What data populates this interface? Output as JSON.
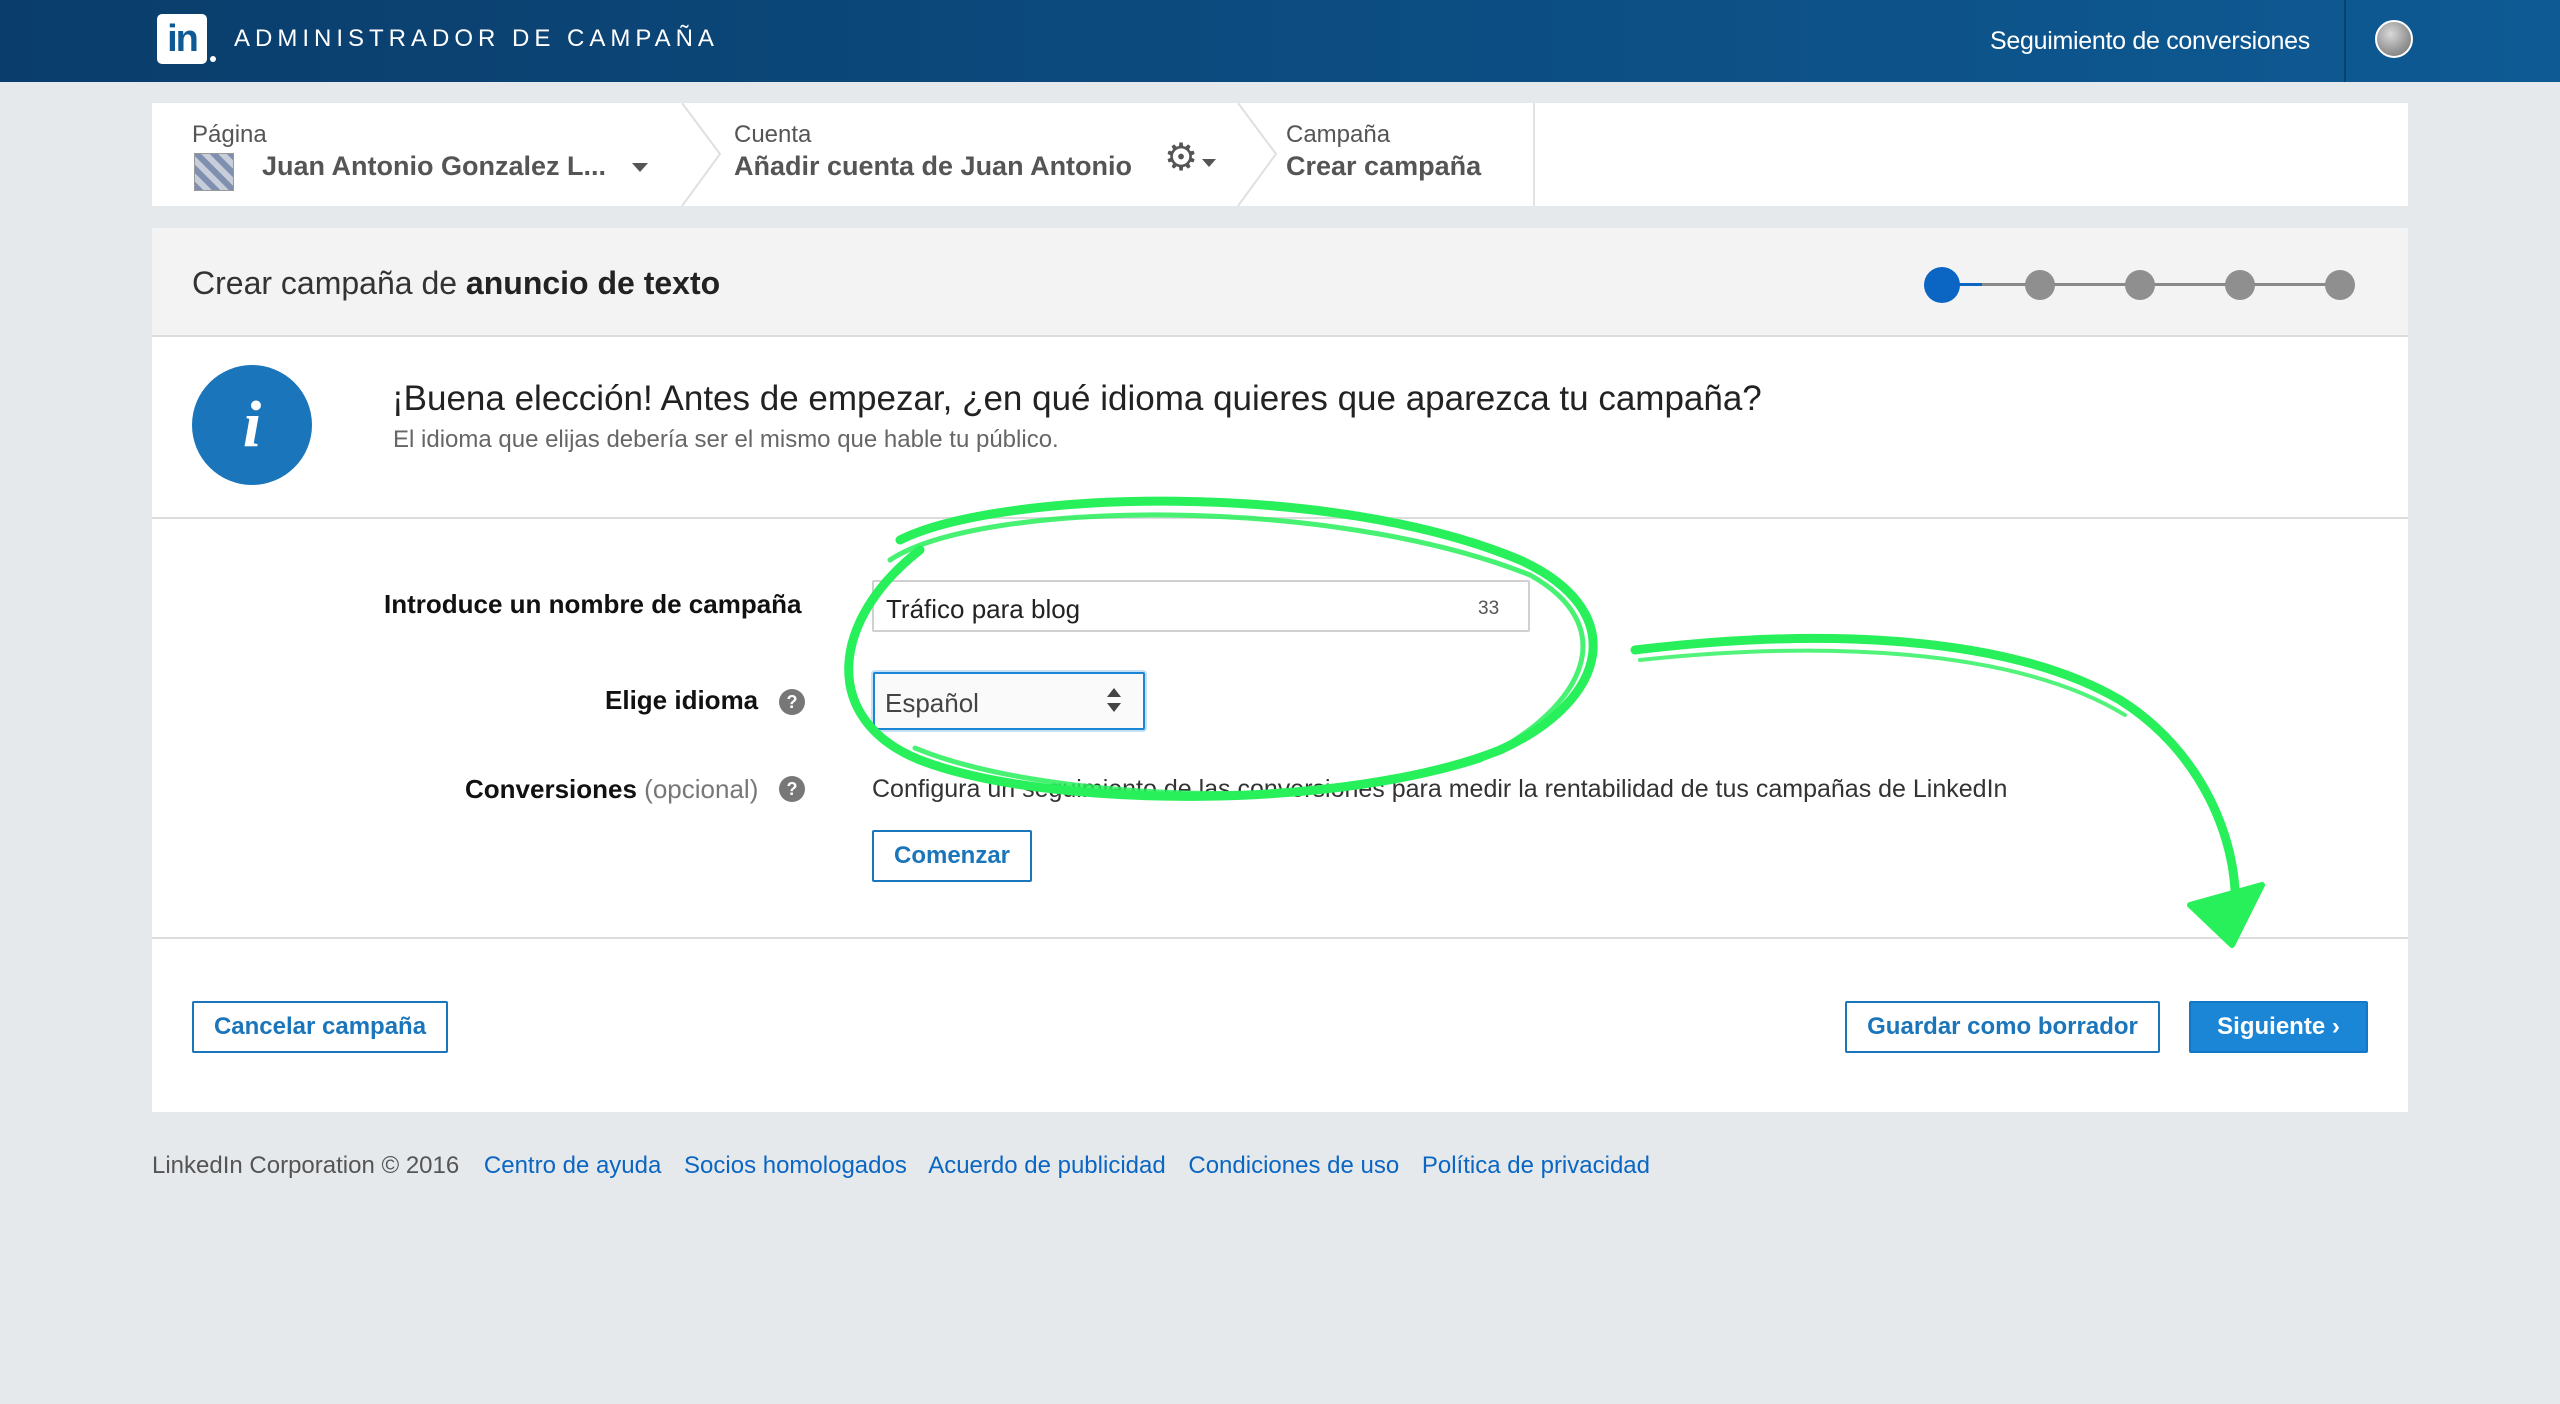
{
  "topbar": {
    "logo_text": "in",
    "brand_title": "ADMINISTRADOR DE CAMPAÑA",
    "conversions_link": "Seguimiento de conversiones"
  },
  "breadcrumb": {
    "page": {
      "label": "Página",
      "value": "Juan Antonio Gonzalez L..."
    },
    "account": {
      "label": "Cuenta",
      "value": "Añadir cuenta de Juan Antonio"
    },
    "campaign": {
      "label": "Campaña",
      "value": "Crear campaña"
    }
  },
  "panel": {
    "title_prefix": "Crear campaña de ",
    "title_bold": "anuncio de texto",
    "steps_total": 5,
    "current_step": 1
  },
  "info": {
    "icon_glyph": "i",
    "title": "¡Buena elección! Antes de empezar, ¿en qué idioma quieres que aparezca tu campaña?",
    "subtitle": "El idioma que elijas debería ser el mismo que hable tu público."
  },
  "form": {
    "name_label": "Introduce un nombre de campaña",
    "name_value": "Tráfico para blog",
    "name_char_count": "33",
    "language_label": "Elige idioma",
    "language_value": "Español",
    "conversions_label": "Conversiones",
    "conversions_optional": " (opcional)",
    "conversions_text": "Configura un seguimiento de las conversiones para medir la rentabilidad de tus campañas de LinkedIn",
    "start_button": "Comenzar",
    "help_glyph": "?"
  },
  "actions": {
    "cancel": "Cancelar campaña",
    "save_draft": "Guardar como borrador",
    "next": "Siguiente ›"
  },
  "footer": {
    "copyright": "LinkedIn Corporation © 2016",
    "links": [
      "Centro de ayuda",
      "Socios homologados",
      "Acuerdo de publicidad",
      "Condiciones de uso",
      "Política de privacidad"
    ]
  },
  "colors": {
    "topbar_start": "#0a3d6b",
    "topbar_end": "#0e5a94",
    "primary": "#1b86d6",
    "link": "#0a66c2",
    "annotation": "#27f05a"
  },
  "icons": {
    "gear": "gear-icon",
    "caret": "chevron-down-icon",
    "info": "info-icon",
    "help": "question-icon"
  }
}
